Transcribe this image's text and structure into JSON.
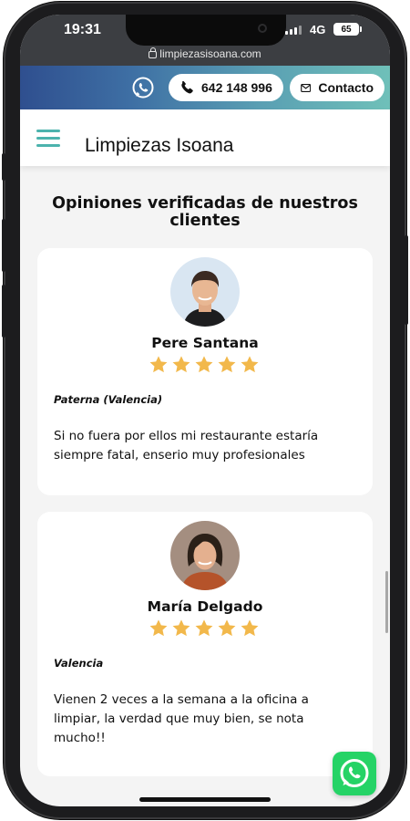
{
  "status_bar": {
    "time": "19:31",
    "network": "4G",
    "battery": "65"
  },
  "browser": {
    "url": "limpiezasisoana.com"
  },
  "topbar": {
    "phone": "642 148 996",
    "contact": "Contacto"
  },
  "header": {
    "brand": "Limpiezas Isoana"
  },
  "section": {
    "title": "Opiniones verificadas de nuestros clientes"
  },
  "reviews": [
    {
      "name": "Pere Santana",
      "rating": 5,
      "location": "Paterna (Valencia)",
      "text": "Si no fuera por ellos mi restaurante estaría siempre fatal, enserio muy profesionales"
    },
    {
      "name": "María Delgado",
      "rating": 5,
      "location": "Valencia",
      "text": "Vienen 2 veces a la semana a la oficina a limpiar, la verdad que muy bien, se nota mucho!!"
    }
  ],
  "colors": {
    "accent_teal": "#4cb3ad",
    "star": "#f2b84b",
    "whatsapp": "#25d366",
    "gradient_start": "#2f4f8f",
    "gradient_end": "#6fc0b9"
  },
  "icons": [
    "whatsapp-icon",
    "phone-icon",
    "mail-icon",
    "hamburger-icon",
    "star-icon",
    "lock-icon"
  ]
}
